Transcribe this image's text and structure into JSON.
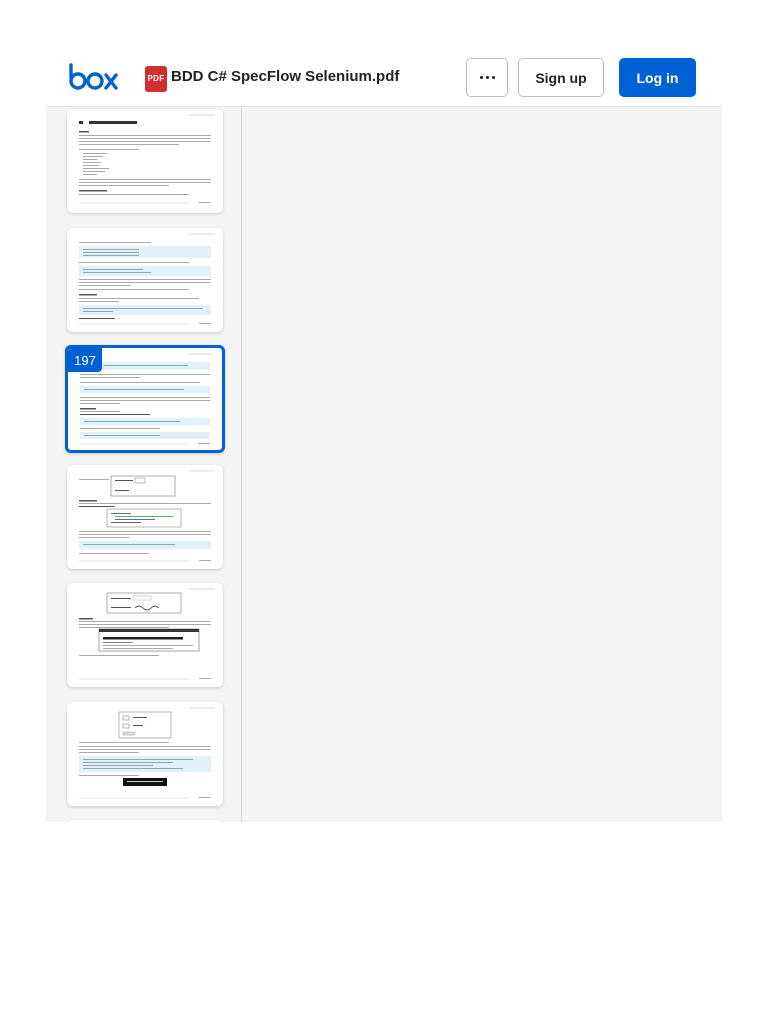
{
  "header": {
    "logo_text": "box",
    "file_type_badge": "PDF",
    "file_title": "BDD C# SpecFlow Selenium.pdf",
    "more_label": "···",
    "signup_label": "Sign up",
    "login_label": "Log in"
  },
  "colors": {
    "brand_blue": "#0061d5",
    "pdf_red": "#d32f2f",
    "viewer_bg": "#f4f4f4"
  },
  "sidebar": {
    "selected_page": "197"
  },
  "icons": {
    "logo": "box-logo",
    "file": "pdf-file-icon",
    "more": "more-options-icon"
  }
}
